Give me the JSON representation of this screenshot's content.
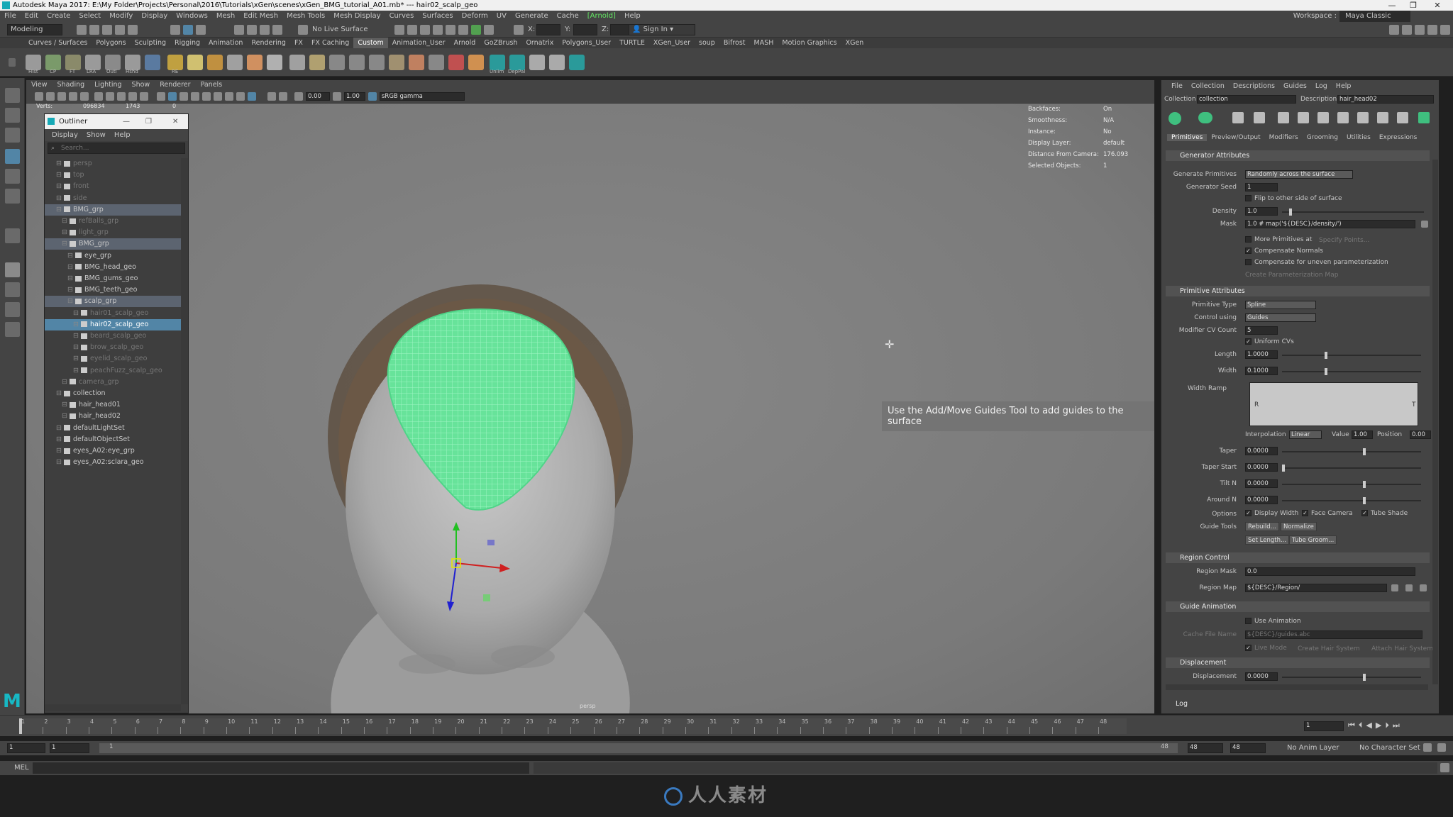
{
  "window": {
    "title": "Autodesk Maya 2017: E:\\My Folder\\Projects\\Personal\\2016\\Tutorials\\xGen\\scenes\\xGen_BMG_tutorial_A01.mb* --- hair02_scalp_geo",
    "controls": [
      "—",
      "❐",
      "✕"
    ]
  },
  "menubar": {
    "items": [
      "File",
      "Edit",
      "Create",
      "Select",
      "Modify",
      "Display",
      "Windows",
      "Mesh",
      "Edit Mesh",
      "Mesh Tools",
      "Mesh Display",
      "Curves",
      "Surfaces",
      "Deform",
      "UV",
      "Generate",
      "Cache",
      "[Arnold]",
      "Help"
    ],
    "workspace_label": "Workspace :",
    "workspace_value": "Maya Classic"
  },
  "statusline": {
    "mode": "Modeling",
    "live_surface": "No Live Surface",
    "x_label": "X:",
    "y_label": "Y:",
    "z_label": "Z:",
    "sign_in": "Sign In"
  },
  "shelf": {
    "tabs": [
      "Curves / Surfaces",
      "Polygons",
      "Sculpting",
      "Rigging",
      "Animation",
      "Rendering",
      "FX",
      "FX Caching",
      "Custom",
      "Animation_User",
      "Arnold",
      "GoZBrush",
      "Ornatrix",
      "Polygons_User",
      "TURTLE",
      "XGen_User",
      "soup",
      "Bifrost",
      "MASH",
      "Motion Graphics",
      "XGen"
    ],
    "active_tab": "Custom",
    "icon_labels": [
      "Hist",
      "CP",
      "FT",
      "LRA",
      "Outl",
      "Hshd",
      "RE",
      "Unlim",
      "DepPal"
    ]
  },
  "viewport": {
    "menu": [
      "View",
      "Shading",
      "Lighting",
      "Show",
      "Renderer",
      "Panels"
    ],
    "exposure": "0.00",
    "gamma": "1.00",
    "color_space": "sRGB gamma",
    "stats": {
      "verts_label": "Verts:",
      "verts_value": "096834",
      "verts_sel": "1743",
      "verts_tri": "0"
    },
    "hud": [
      {
        "label": "Backfaces:",
        "value": "On"
      },
      {
        "label": "Smoothness:",
        "value": "N/A"
      },
      {
        "label": "Instance:",
        "value": "No"
      },
      {
        "label": "Display Layer:",
        "value": "default"
      },
      {
        "label": "Distance From Camera:",
        "value": "176.093"
      },
      {
        "label": "Selected Objects:",
        "value": "1"
      }
    ],
    "message": "Use the Add/Move Guides Tool to add guides to the surface",
    "camera": "persp"
  },
  "outliner": {
    "title": "Outliner",
    "menu": [
      "Display",
      "Show",
      "Help"
    ],
    "search_placeholder": "Search...",
    "rows": [
      {
        "label": "persp",
        "indent": 1,
        "state": "dim"
      },
      {
        "label": "top",
        "indent": 1,
        "state": "dim"
      },
      {
        "label": "front",
        "indent": 1,
        "state": "dim"
      },
      {
        "label": "side",
        "indent": 1,
        "state": "dim"
      },
      {
        "label": "BMG_grp",
        "indent": 1,
        "state": "hl"
      },
      {
        "label": "refBalls_grp",
        "indent": 2,
        "state": "dim"
      },
      {
        "label": "light_grp",
        "indent": 2,
        "state": "dim"
      },
      {
        "label": "BMG_grp",
        "indent": 2,
        "state": "hl"
      },
      {
        "label": "eye_grp",
        "indent": 3,
        "state": ""
      },
      {
        "label": "BMG_head_geo",
        "indent": 3,
        "state": ""
      },
      {
        "label": "BMG_gums_geo",
        "indent": 3,
        "state": ""
      },
      {
        "label": "BMG_teeth_geo",
        "indent": 3,
        "state": ""
      },
      {
        "label": "scalp_grp",
        "indent": 3,
        "state": "hl"
      },
      {
        "label": "hair01_scalp_geo",
        "indent": 4,
        "state": "dim"
      },
      {
        "label": "hair02_scalp_geo",
        "indent": 4,
        "state": "sel"
      },
      {
        "label": "beard_scalp_geo",
        "indent": 4,
        "state": "dim"
      },
      {
        "label": "brow_scalp_geo",
        "indent": 4,
        "state": "dim"
      },
      {
        "label": "eyelid_scalp_geo",
        "indent": 4,
        "state": "dim"
      },
      {
        "label": "peachFuzz_scalp_geo",
        "indent": 4,
        "state": "dim"
      },
      {
        "label": "camera_grp",
        "indent": 2,
        "state": "dim"
      },
      {
        "label": "collection",
        "indent": 1,
        "state": ""
      },
      {
        "label": "hair_head01",
        "indent": 2,
        "state": ""
      },
      {
        "label": "hair_head02",
        "indent": 2,
        "state": ""
      },
      {
        "label": "defaultLightSet",
        "indent": 1,
        "state": ""
      },
      {
        "label": "defaultObjectSet",
        "indent": 1,
        "state": ""
      },
      {
        "label": "eyes_A02:eye_grp",
        "indent": 1,
        "state": ""
      },
      {
        "label": "eyes_A02:sclara_geo",
        "indent": 1,
        "state": ""
      }
    ]
  },
  "xgen": {
    "menu": [
      "File",
      "Collection",
      "Descriptions",
      "Guides",
      "Log",
      "Help"
    ],
    "collection_label": "Collection",
    "collection_value": "collection",
    "description_label": "Description",
    "description_value": "hair_head02",
    "tabs": [
      "Primitives",
      "Preview/Output",
      "Modifiers",
      "Grooming",
      "Utilities",
      "Expressions"
    ],
    "active_tab": "Primitives",
    "generator": {
      "header": "Generator Attributes",
      "generate_primitives_label": "Generate Primitives",
      "generate_primitives_value": "Randomly across the surface",
      "seed_label": "Generator Seed",
      "seed_value": "1",
      "flip_label": "Flip to other side of surface",
      "density_label": "Density",
      "density_value": "1.0",
      "mask_label": "Mask",
      "mask_value": "1.0 # map('${DESC}/density/')",
      "more_primitives": "More Primitives at",
      "specify_points": "Specify Points...",
      "compensate_normals": "Compensate Normals",
      "compensate_uneven": "Compensate for uneven parameterization",
      "create_param_map": "Create Parameterization Map"
    },
    "primitive": {
      "header": "Primitive Attributes",
      "type_label": "Primitive Type",
      "type_value": "Spline",
      "control_label": "Control using",
      "control_value": "Guides",
      "cv_label": "Modifier CV Count",
      "cv_value": "5",
      "uniform_cvs": "Uniform CVs",
      "length_label": "Length",
      "length_value": "1.0000",
      "width_label": "Width",
      "width_value": "0.1000",
      "width_ramp_label": "Width Ramp",
      "ramp_r": "R",
      "ramp_t": "T",
      "interp_label": "Interpolation",
      "interp_value": "Linear",
      "value_label": "Value",
      "value_value": "1.00",
      "position_label": "Position",
      "position_value": "0.00",
      "taper_label": "Taper",
      "taper_value": "0.0000",
      "taper_start_label": "Taper Start",
      "taper_start_value": "0.0000",
      "tilt_label": "Tilt N",
      "tilt_value": "0.0000",
      "around_label": "Around N",
      "around_value": "0.0000",
      "options_label": "Options",
      "display_width": "Display Width",
      "face_camera": "Face Camera",
      "tube_shade": "Tube Shade",
      "guide_tools_label": "Guide Tools",
      "rebuild": "Rebuild...",
      "normalize": "Normalize",
      "set_length": "Set Length...",
      "tube_groom": "Tube Groom..."
    },
    "region": {
      "header": "Region Control",
      "mask_label": "Region Mask",
      "mask_value": "0.0",
      "map_label": "Region Map",
      "map_value": "${DESC}/Region/"
    },
    "guide_anim": {
      "header": "Guide Animation",
      "use_animation": "Use Animation",
      "cache_label": "Cache File Name",
      "cache_value": "${DESC}/guides.abc",
      "live_mode": "Live Mode",
      "create_hair": "Create Hair System",
      "attach_hair": "Attach Hair System"
    },
    "displacement": {
      "header": "Displacement",
      "label": "Displacement",
      "value": "0.0000"
    },
    "log": "Log"
  },
  "timeline": {
    "ticks": [
      "1",
      "2",
      "3",
      "4",
      "5",
      "6",
      "7",
      "8",
      "9",
      "10",
      "11",
      "12",
      "13",
      "14",
      "15",
      "16",
      "17",
      "18",
      "19",
      "20",
      "21",
      "22",
      "23",
      "24",
      "25",
      "26",
      "27",
      "28",
      "29",
      "30",
      "31",
      "32",
      "33",
      "34",
      "35",
      "36",
      "37",
      "38",
      "39",
      "40",
      "41",
      "42",
      "43",
      "44",
      "45",
      "46",
      "47",
      "48"
    ],
    "current_frame": "1"
  },
  "range": {
    "start": "1",
    "playback_start": "1",
    "range_start": "1",
    "range_end": "48",
    "playback_end": "48",
    "end": "48",
    "anim_layer": "No Anim Layer",
    "character_set": "No Character Set"
  },
  "command": {
    "label": "MEL"
  },
  "watermark": "人人素材"
}
